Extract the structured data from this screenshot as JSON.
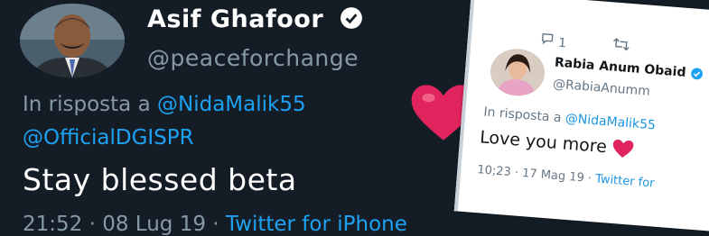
{
  "main_tweet": {
    "author_name": "Asif Ghafoor",
    "handle": "@peaceforchange",
    "reply_prefix": "In risposta a",
    "reply_mention_1": "@NidaMalik55",
    "reply_mention_2": "@OfficialDGISPR",
    "text": "Stay blessed beta",
    "timestamp": "21:52 · 08 Lug 19 ·",
    "source": "Twitter for iPhone",
    "icons": [
      "avatar",
      "verified-badge-icon",
      "heart-icon"
    ]
  },
  "reply_tweet": {
    "reply_count": "1",
    "author_name": "Rabia Anum Obaid",
    "handle": "@RabiaAnumm",
    "reply_prefix": "In risposta a",
    "reply_mention": "@NidaMalik55",
    "text": "Love you more",
    "timestamp": "10;23 · 17 Mag 19 ·",
    "source": "Twitter for",
    "icons": [
      "comment-icon",
      "retweet-icon",
      "verified-badge-icon",
      "heart-icon"
    ]
  },
  "colors": {
    "dark_bg": "#141d26",
    "link_blue": "#1da1f2",
    "muted": "#8899a6",
    "heart_red": "#e0245e"
  }
}
